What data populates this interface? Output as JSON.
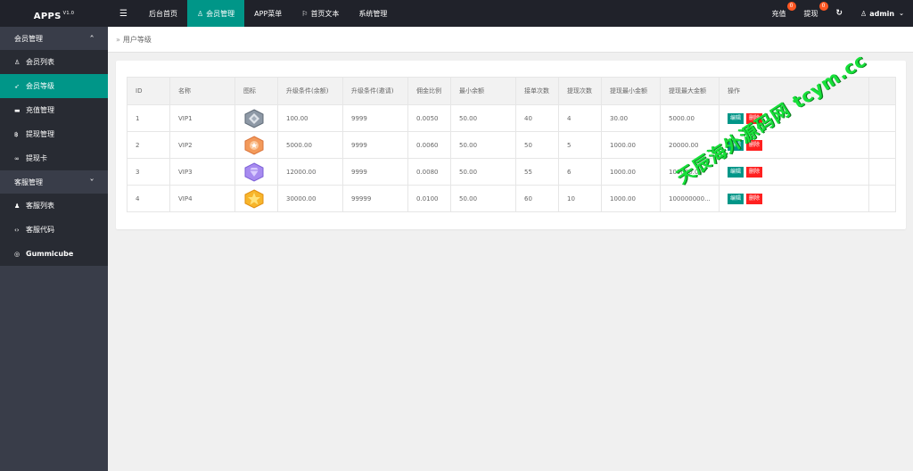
{
  "app": {
    "title": "APPS",
    "version": "V1.0"
  },
  "topnav": {
    "items": [
      {
        "label": "后台首页"
      },
      {
        "label": "会员管理",
        "active": true
      },
      {
        "label": "APP菜单"
      },
      {
        "label": "首页文本"
      },
      {
        "label": "系统管理"
      }
    ],
    "recharge_label": "充值",
    "recharge_count": "0",
    "withdraw_label": "提现",
    "withdraw_count": "0",
    "user": "admin"
  },
  "sidebar": {
    "groups": [
      {
        "label": "会员管理",
        "items": [
          {
            "label": "会员列表",
            "icon": "user-icon"
          },
          {
            "label": "会员等级",
            "icon": "rocket-icon",
            "active": true
          },
          {
            "label": "充值管理",
            "icon": "wallet-icon"
          },
          {
            "label": "提现管理",
            "icon": "bitcoin-icon"
          },
          {
            "label": "提现卡",
            "icon": "link-icon"
          }
        ]
      },
      {
        "label": "客服管理",
        "items": [
          {
            "label": "客服列表",
            "icon": "users-icon"
          },
          {
            "label": "客服代码",
            "icon": "code-icon"
          },
          {
            "label": "Gummicube",
            "icon": "cube-icon"
          }
        ]
      }
    ]
  },
  "breadcrumb": "用户等级",
  "table": {
    "headers": [
      "ID",
      "名称",
      "图标",
      "升级条件(余额)",
      "升级条件(邀请)",
      "佣金比例",
      "最小余额",
      "接单次数",
      "提现次数",
      "提现最小金额",
      "提现最大金额",
      "操作"
    ],
    "rows": [
      {
        "id": "1",
        "name": "VIP1",
        "icon": "silver-badge-icon",
        "up_balance": "100.00",
        "up_invite": "9999",
        "commission": "0.0050",
        "min_balance": "50.00",
        "orders": "40",
        "withdraw_times": "4",
        "withdraw_min": "30.00",
        "withdraw_max": "5000.00"
      },
      {
        "id": "2",
        "name": "VIP2",
        "icon": "orange-badge-icon",
        "up_balance": "5000.00",
        "up_invite": "9999",
        "commission": "0.0060",
        "min_balance": "50.00",
        "orders": "50",
        "withdraw_times": "5",
        "withdraw_min": "1000.00",
        "withdraw_max": "20000.00"
      },
      {
        "id": "3",
        "name": "VIP3",
        "icon": "purple-diamond-badge-icon",
        "up_balance": "12000.00",
        "up_invite": "9999",
        "commission": "0.0080",
        "min_balance": "50.00",
        "orders": "55",
        "withdraw_times": "6",
        "withdraw_min": "1000.00",
        "withdraw_max": "100000.00"
      },
      {
        "id": "4",
        "name": "VIP4",
        "icon": "gold-star-badge-icon",
        "up_balance": "30000.00",
        "up_invite": "99999",
        "commission": "0.0100",
        "min_balance": "50.00",
        "orders": "60",
        "withdraw_times": "10",
        "withdraw_min": "1000.00",
        "withdraw_max": "100000000..."
      }
    ],
    "edit_label": "编辑",
    "delete_label": "删除"
  },
  "watermark": "天辰海外源码网 tcym.cc",
  "colors": {
    "accent": "#009688",
    "topbar": "#20222a",
    "sidebar": "#393d49",
    "danger": "#ff2020",
    "badge": "#ff5722",
    "watermark": "#17e03a"
  }
}
